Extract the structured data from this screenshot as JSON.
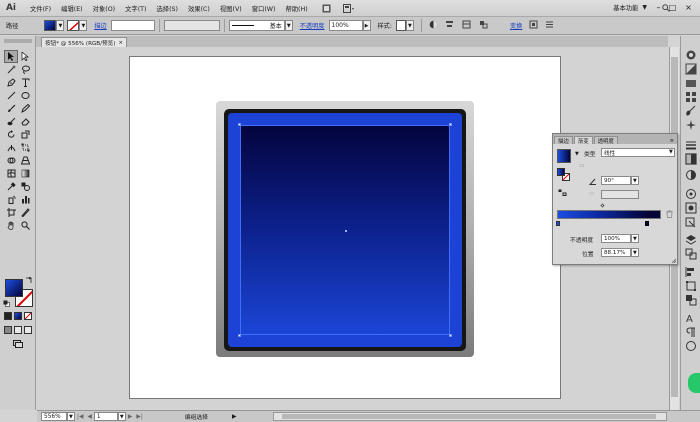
{
  "app": {
    "logo": "Ai",
    "menus": [
      "文件(F)",
      "编辑(E)",
      "对象(O)",
      "文字(T)",
      "选择(S)",
      "效果(C)",
      "视图(V)",
      "窗口(W)",
      "帮助(H)"
    ],
    "workspace": "基本功能",
    "window_controls": [
      "–",
      "□",
      "×"
    ]
  },
  "control_bar": {
    "selection_label": "路径",
    "stroke_label": "描边",
    "stroke_style": "基本",
    "opacity_label": "不透明度",
    "opacity_value": "100%",
    "style_label": "样式:",
    "transform_label": "变换"
  },
  "document": {
    "tab_title": "按钮* @ 556% (RGB/预览)",
    "tab_close": "×"
  },
  "gradient_panel": {
    "tabs": [
      "描边",
      "渐变",
      "透明度"
    ],
    "active_tab": "渐变",
    "type_label": "类型",
    "type_value": "线性",
    "angle_value": "90°",
    "opacity_label": "不透明度",
    "opacity_value": "100%",
    "position_label": "位置",
    "position_value": "88.17%"
  },
  "status_bar": {
    "zoom": "556%",
    "page": "1",
    "tool_status": "编组选择"
  },
  "colors": {
    "gradient_start": "#1a4ee0",
    "gradient_end": "#040436",
    "stroke_none": "#e20000",
    "link_blue": "#1a3fbf"
  }
}
